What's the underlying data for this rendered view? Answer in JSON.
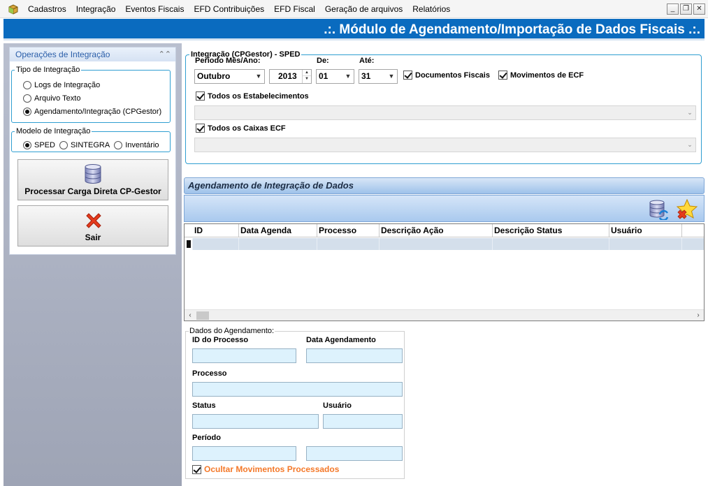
{
  "menu": {
    "items": [
      "Cadastros",
      "Integração",
      "Eventos Fiscais",
      "EFD Contribuições",
      "EFD Fiscal",
      "Geração de arquivos",
      "Relatórios"
    ]
  },
  "window_buttons": [
    "minimize-icon",
    "restore-icon",
    "close-icon"
  ],
  "header": {
    "title": ".:. Módulo de Agendamento/Importação de Dados Fiscais .:."
  },
  "left": {
    "panel_title": "Operações de Integração",
    "tipo_group": {
      "legend": "Tipo de Integração",
      "options": [
        "Logs de Integração",
        "Arquivo Texto",
        "Agendamento/Integração (CPGestor)"
      ],
      "selected_index": 2
    },
    "modelo_group": {
      "legend": "Modelo de Integração",
      "options": [
        "SPED",
        "SINTEGRA",
        "Inventário"
      ],
      "selected_index": 0
    },
    "process_button": "Processar Carga Direta CP-Gestor",
    "exit_button": "Sair"
  },
  "sped": {
    "legend": "Integração (CPGestor) - SPED",
    "periodo_label": "Período Mês/Ano:",
    "mes_value": "Outubro",
    "ano_value": "2013",
    "de_label": "De:",
    "de_value": "01",
    "ate_label": "Até:",
    "ate_value": "31",
    "doc_fiscais_label": "Documentos Fiscais",
    "doc_fiscais_checked": true,
    "mov_ecf_label": "Movimentos de ECF",
    "mov_ecf_checked": true,
    "todos_estab_label": "Todos os Estabelecimentos",
    "todos_estab_checked": true,
    "todos_caixas_label": "Todos os Caixas ECF",
    "todos_caixas_checked": true
  },
  "agendamento": {
    "title": "Agendamento de Integração de Dados",
    "columns": [
      "ID",
      "Data Agenda",
      "Processo",
      "Descrição Ação",
      "Descrição Status",
      "Usuário"
    ],
    "rows": []
  },
  "dados": {
    "legend": "Dados do Agendamento:",
    "id_label": "ID do Processo",
    "data_label": "Data Agendamento",
    "processo_label": "Processo",
    "status_label": "Status",
    "usuario_label": "Usuário",
    "periodo_label": "Período",
    "ocultar_label": "Ocultar Movimentos Processados",
    "ocultar_checked": true
  },
  "colors": {
    "header_blue": "#0a6bbf",
    "accent_orange": "#f4792a",
    "field_blue": "#ddf2fd"
  }
}
